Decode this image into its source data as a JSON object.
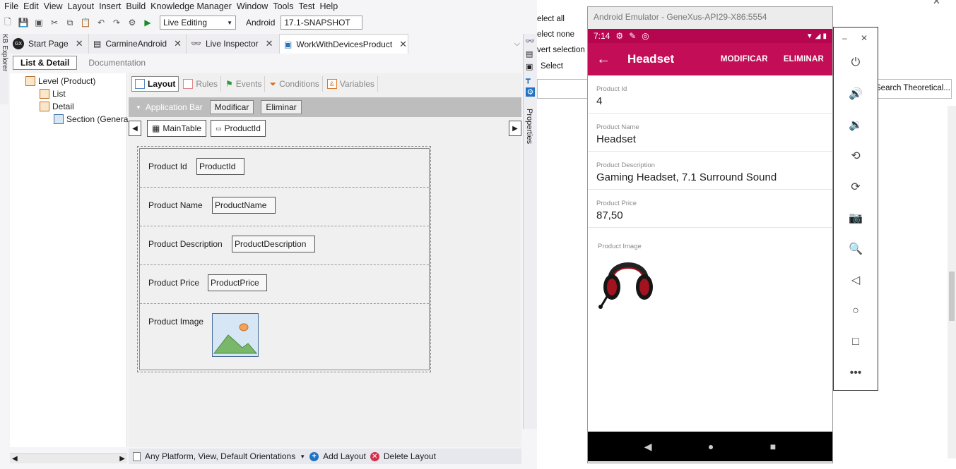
{
  "menu": [
    "File",
    "Edit",
    "View",
    "Layout",
    "Insert",
    "Build",
    "Knowledge Manager",
    "Window",
    "Tools",
    "Test",
    "Help"
  ],
  "toolbar": {
    "mode_select": "Live Editing",
    "platform_label": "Android",
    "version": "17.1-SNAPSHOT"
  },
  "tabs": [
    {
      "label": "Start Page"
    },
    {
      "label": "CarmineAndroid"
    },
    {
      "label": "Live Inspector"
    },
    {
      "label": "WorkWithDevicesProduct"
    }
  ],
  "kb_explorer": "KB Explorer",
  "subtabs": {
    "list_detail": "List & Detail",
    "documentation": "Documentation"
  },
  "tree": {
    "level": "Level (Product)",
    "list": "List",
    "detail": "Detail",
    "section": "Section (Genera"
  },
  "design_tabs": [
    "Layout",
    "Rules",
    "Events",
    "Conditions",
    "Variables"
  ],
  "appbar": {
    "label": "Application Bar",
    "modificar": "Modificar",
    "eliminar": "Eliminar"
  },
  "crumbs": {
    "main_table": "MainTable",
    "product_id": "ProductId"
  },
  "form_rows": [
    {
      "label": "Product Id",
      "control": "ProductId"
    },
    {
      "label": "Product Name",
      "control": "ProductName"
    },
    {
      "label": "Product Description",
      "control": "ProductDescription"
    },
    {
      "label": "Product Price",
      "control": "ProductPrice"
    },
    {
      "label": "Product Image",
      "control": ""
    }
  ],
  "bottom": {
    "platform": "Any Platform, View, Default Orientations",
    "add": "Add Layout",
    "delete": "Delete Layout"
  },
  "properties_tab": "Properties",
  "background_menu": [
    "elect all",
    "elect none",
    "vert selection",
    "Select"
  ],
  "background_search": "Search Theoretical...",
  "emulator": {
    "title": "Android Emulator - GeneXus-API29-X86:5554",
    "time": "7:14",
    "app_title": "Headset",
    "action_modify": "MODIFICAR",
    "action_delete": "ELIMINAR",
    "fields": [
      {
        "caption": "Product Id",
        "value": "4"
      },
      {
        "caption": "Product Name",
        "value": "Headset"
      },
      {
        "caption": "Product Description",
        "value": "Gaming Headset, 7.1 Surround Sound"
      },
      {
        "caption": "Product Price",
        "value": "87,50"
      }
    ],
    "image_caption": "Product Image",
    "accent": "#c30e57"
  }
}
